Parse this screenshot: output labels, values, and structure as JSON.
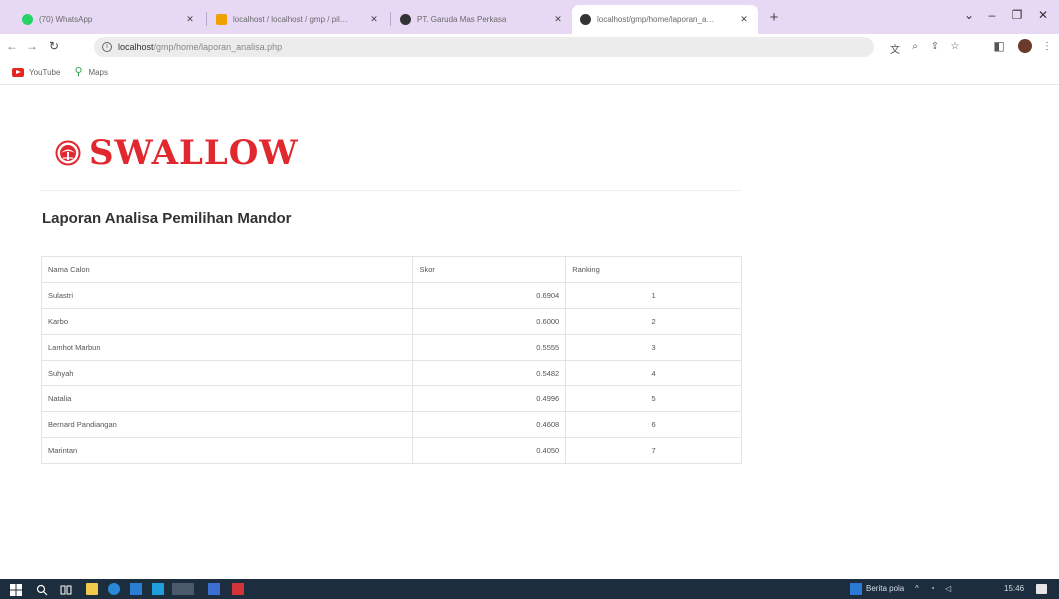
{
  "browser": {
    "tabs": [
      {
        "label": "(70) WhatsApp",
        "icon": "whatsapp-icon",
        "color": "#25d366",
        "active": false
      },
      {
        "label": "localhost / localhost / gmp / pil…",
        "icon": "phpmyadmin-icon",
        "color": "#f0a000",
        "active": false
      },
      {
        "label": "PT. Garuda Mas Perkasa",
        "icon": "globe-icon",
        "color": "#333333",
        "active": false
      },
      {
        "label": "localhost/gmp/home/laporan_a…",
        "icon": "globe-icon",
        "color": "#333333",
        "active": true
      }
    ],
    "new_tab": "+",
    "window_controls": {
      "dropdown": "⌄",
      "minimize": "–",
      "maximize": "❐",
      "close": "✕"
    },
    "url_host": "localhost",
    "url_path": "/gmp/home/laporan_analisa.php",
    "bookmarks": [
      {
        "label": "YouTube",
        "icon": "youtube-icon"
      },
      {
        "label": "Maps",
        "icon": "maps-icon"
      }
    ]
  },
  "page": {
    "logo_text": "SWALLOW",
    "title": "Laporan Analisa Pemilihan Mandor",
    "table": {
      "headers": [
        "Nama Calon",
        "Skor",
        "Ranking"
      ],
      "rows": [
        [
          "Sulastri",
          "0.6904",
          "1"
        ],
        [
          "Karbo",
          "0.6000",
          "2"
        ],
        [
          "Lamhot Marbun",
          "0.5555",
          "3"
        ],
        [
          "Suhyah",
          "0.5482",
          "4"
        ],
        [
          "Natalia",
          "0.4996",
          "5"
        ],
        [
          "Bernard Pandiangan",
          "0.4608",
          "6"
        ],
        [
          "Marintan",
          "0.4050",
          "7"
        ]
      ]
    }
  },
  "taskbar": {
    "weather": "Berita pola",
    "clock": "15:46"
  },
  "colors": {
    "brand_red": "#e1282f",
    "tabstrip": "#e7d9f4",
    "taskbar": "#1c2d3e"
  }
}
